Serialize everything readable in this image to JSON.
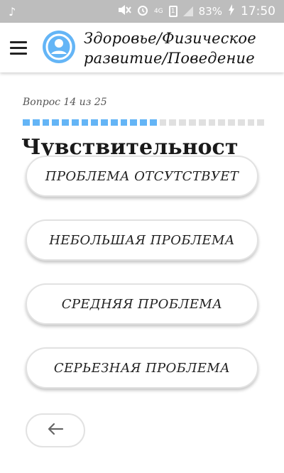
{
  "status_bar": {
    "network_type": "4G",
    "sim_label": "1",
    "battery_percent": "83%",
    "time": "17:50",
    "icons": [
      "music-note-icon",
      "mute-icon",
      "alarm-icon",
      "signal-icon",
      "battery-charging-icon"
    ]
  },
  "app_bar": {
    "title_line1": "Здоровье/Физическое",
    "title_line2": "развитие/Поведение",
    "menu_icon": "hamburger-menu-icon",
    "avatar_icon": "account-circle-icon",
    "avatar_color": "#64b5f6"
  },
  "progress": {
    "label": "Вопрос 14 из 25",
    "current": 14,
    "total": 25,
    "accent_color": "#64b5f6"
  },
  "question": {
    "title": "Чувствительност"
  },
  "answers": [
    {
      "label": "ПРОБЛЕМА ОТСУТСТВУЕТ"
    },
    {
      "label": "НЕБОЛЬШАЯ ПРОБЛЕМА"
    },
    {
      "label": "СРЕДНЯЯ ПРОБЛЕМА"
    },
    {
      "label": "СЕРЬЕЗНАЯ ПРОБЛЕМА"
    }
  ],
  "navigation": {
    "back_icon": "arrow-left-icon"
  }
}
